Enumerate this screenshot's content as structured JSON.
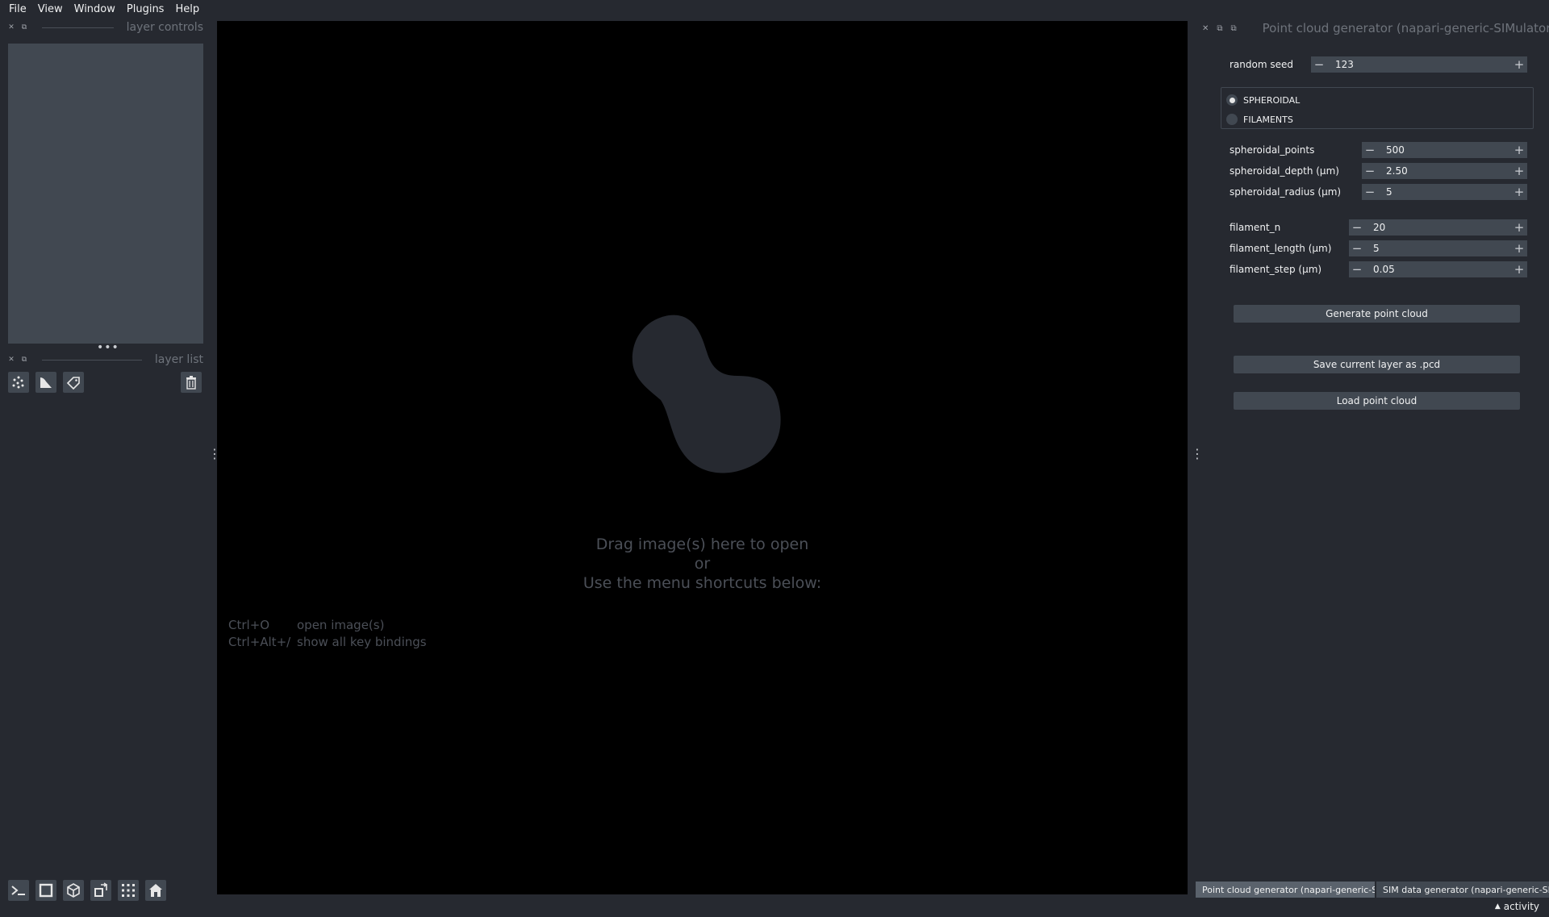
{
  "menubar": {
    "items": [
      "File",
      "View",
      "Window",
      "Plugins",
      "Help"
    ]
  },
  "left_dock": {
    "layer_controls_title": "layer controls",
    "layer_list_title": "layer list",
    "buttons": {
      "new_points_icon": "points-icon",
      "new_shapes_icon": "shapes-icon",
      "new_labels_icon": "labels-icon",
      "delete_icon": "trash-icon"
    },
    "viewer_buttons": [
      "console-icon",
      "ndisplay-icon",
      "3d-cube-icon",
      "transpose-icon",
      "grid-icon",
      "home-icon"
    ]
  },
  "canvas": {
    "welcome_line1": "Drag image(s) here to open",
    "welcome_line2": "or",
    "welcome_line3": "Use the menu shortcuts below:",
    "shortcuts": [
      {
        "key": "Ctrl+O",
        "desc": "open image(s)"
      },
      {
        "key": "Ctrl+Alt+/",
        "desc": "show all key bindings"
      }
    ]
  },
  "right_dock": {
    "title": "Point cloud generator (napari-generic-SIMulator)",
    "random_seed": {
      "label": "random seed",
      "value": "123"
    },
    "radio": {
      "options": [
        "SPHEROIDAL",
        "FILAMENTS"
      ],
      "selected": "SPHEROIDAL"
    },
    "spheroidal": [
      {
        "label": "spheroidal_points",
        "value": "500"
      },
      {
        "label": "spheroidal_depth (μm)",
        "value": "2.50"
      },
      {
        "label": "spheroidal_radius (μm)",
        "value": "5"
      }
    ],
    "filament": [
      {
        "label": "filament_n",
        "value": "20"
      },
      {
        "label": "filament_length (μm)",
        "value": "5"
      },
      {
        "label": "filament_step (μm)",
        "value": "0.05"
      }
    ],
    "buttons": {
      "generate": "Generate point cloud",
      "save": "Save current layer as .pcd",
      "load": "Load point cloud"
    }
  },
  "dock_tabs": [
    {
      "label": "Point cloud generator (napari-generic-SI...",
      "active": true
    },
    {
      "label": "SIM data generator (napari-generic-SI...",
      "active": false
    }
  ],
  "statusbar": {
    "activity_label": "activity"
  },
  "colors": {
    "background": "#262930",
    "panel": "#414851",
    "canvas": "#000000",
    "text": "#f0f1f2"
  }
}
